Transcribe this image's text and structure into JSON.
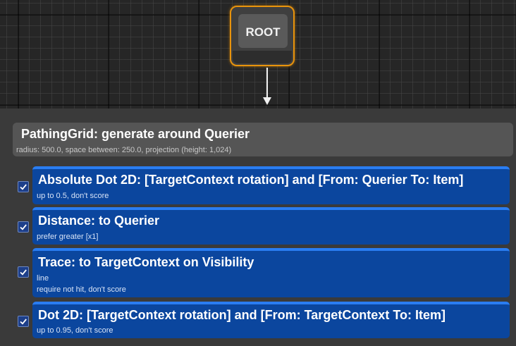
{
  "root": {
    "label": "ROOT"
  },
  "generator": {
    "title": "PathingGrid: generate around Querier",
    "subtitle": "radius: 500.0, space between: 250.0, projection (height: 1,024)"
  },
  "tests": [
    {
      "title": "Absolute Dot 2D: [TargetContext rotation] and [From: Querier To: Item]",
      "lines": [
        "up to 0.5, don't score"
      ],
      "checked": true
    },
    {
      "title": "Distance: to Querier",
      "lines": [
        "prefer greater [x1]"
      ],
      "checked": true
    },
    {
      "title": "Trace: to TargetContext on Visibility",
      "lines": [
        "line",
        "require not hit, don't score"
      ],
      "checked": true
    },
    {
      "title": "Dot 2D: [TargetContext rotation] and [From: TargetContext To: Item]",
      "lines": [
        "up to 0.95, don't score"
      ],
      "checked": true
    }
  ],
  "colors": {
    "root_border": "#e8930c",
    "test_card": "#0b469e",
    "test_accent": "#2a7df2",
    "checkbox": "#1d3f8a"
  },
  "icons": {
    "checkbox": "checkmark-icon",
    "connector": "arrow-down-icon"
  }
}
